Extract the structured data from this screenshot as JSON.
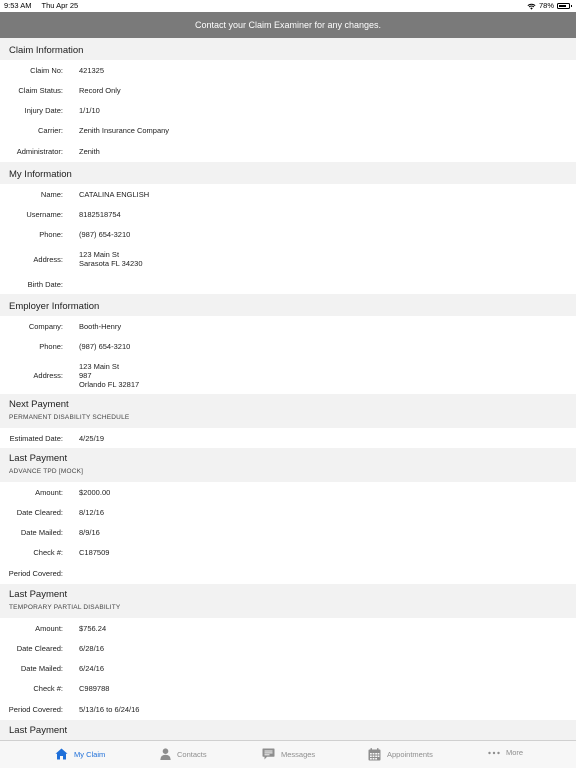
{
  "status": {
    "time": "9:53 AM",
    "date": "Thu Apr 25",
    "battery": "78%"
  },
  "banner": "Contact your Claim Examiner for any changes.",
  "claim": {
    "title": "Claim Information",
    "rows": [
      {
        "label": "Claim No:",
        "value": "421325"
      },
      {
        "label": "Claim Status:",
        "value": "Record Only"
      },
      {
        "label": "Injury Date:",
        "value": "1/1/10"
      },
      {
        "label": "Carrier:",
        "value": "Zenith Insurance Company"
      },
      {
        "label": "Administrator:",
        "value": "Zenith"
      }
    ]
  },
  "my_info": {
    "title": "My Information",
    "name_label": "Name:",
    "name": "CATALINA ENGLISH",
    "username_label": "Username:",
    "username": "8182518754",
    "phone_label": "Phone:",
    "phone": "(987) 654-3210",
    "address_label": "Address:",
    "address_line1": "123 Main St",
    "address_line2": "Sarasota FL 34230",
    "birth_label": "Birth Date:",
    "birth": ""
  },
  "employer": {
    "title": "Employer Information",
    "company_label": "Company:",
    "company": "Booth-Henry",
    "phone_label": "Phone:",
    "phone": "(987) 654-3210",
    "address_label": "Address:",
    "address_line1": "123 Main St",
    "address_line2": "987",
    "address_line3": "Orlando FL 32817"
  },
  "next_payment": {
    "title": "Next Payment",
    "subtitle": "PERMANENT DISABILITY SCHEDULE",
    "est_label": "Estimated Date:",
    "est": "4/25/19"
  },
  "last_payment_1": {
    "title": "Last Payment",
    "subtitle": "ADVANCE TPD [MOCK]",
    "amount_label": "Amount:",
    "amount": "$2000.00",
    "cleared_label": "Date Cleared:",
    "cleared": "8/12/16",
    "mailed_label": "Date Mailed:",
    "mailed": "8/9/16",
    "check_label": "Check #:",
    "check": "C187509",
    "period_label": "Period Covered:",
    "period": ""
  },
  "last_payment_2": {
    "title": "Last Payment",
    "subtitle": "TEMPORARY PARTIAL DISABILITY",
    "amount_label": "Amount:",
    "amount": "$756.24",
    "cleared_label": "Date Cleared:",
    "cleared": "6/28/16",
    "mailed_label": "Date Mailed:",
    "mailed": "6/24/16",
    "check_label": "Check #:",
    "check": "C989788",
    "period_label": "Period Covered:",
    "period": "5/13/16 to 6/24/16"
  },
  "last_payment_3": {
    "title": "Last Payment"
  },
  "tabs": [
    {
      "label": "My Claim",
      "icon": "home-icon"
    },
    {
      "label": "Contacts",
      "icon": "person-icon"
    },
    {
      "label": "Messages",
      "icon": "message-icon"
    },
    {
      "label": "Appointments",
      "icon": "calendar-icon"
    },
    {
      "label": "More",
      "icon": "more-icon"
    }
  ],
  "colors": {
    "accent": "#1e6fd9",
    "banner": "#7a7a7a",
    "section": "#f2f2f2"
  }
}
